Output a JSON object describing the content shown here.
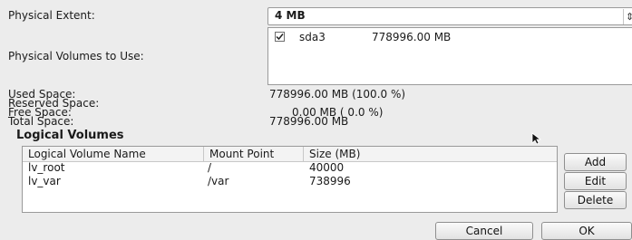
{
  "form": {
    "physical_extent_label": "Physical Extent:",
    "physical_extent_value": "4 MB",
    "pv_label": "Physical Volumes to Use:",
    "pv_items": [
      {
        "name": "sda3",
        "size": "778996.00 MB",
        "checked": true
      }
    ],
    "used_label": "Used Space:",
    "reserved_label": "Reserved Space:",
    "free_label": "Free Space:",
    "total_label": "Total Space:",
    "used_value": "778996.00 MB  (100.0 %)",
    "free_value": "0.00 MB  ( 0.0 %)",
    "total_value": "778996.00 MB"
  },
  "logical_volumes": {
    "title": "Logical Volumes",
    "columns": [
      "Logical Volume Name",
      "Mount Point",
      "Size (MB)"
    ],
    "rows": [
      {
        "name": "lv_root",
        "mount": "/",
        "size": "40000"
      },
      {
        "name": "lv_var",
        "mount": "/var",
        "size": "738996"
      }
    ],
    "add_label": "Add",
    "edit_label": "Edit",
    "delete_label": "Delete"
  },
  "dialog": {
    "cancel_label": "Cancel",
    "ok_label": "OK"
  }
}
